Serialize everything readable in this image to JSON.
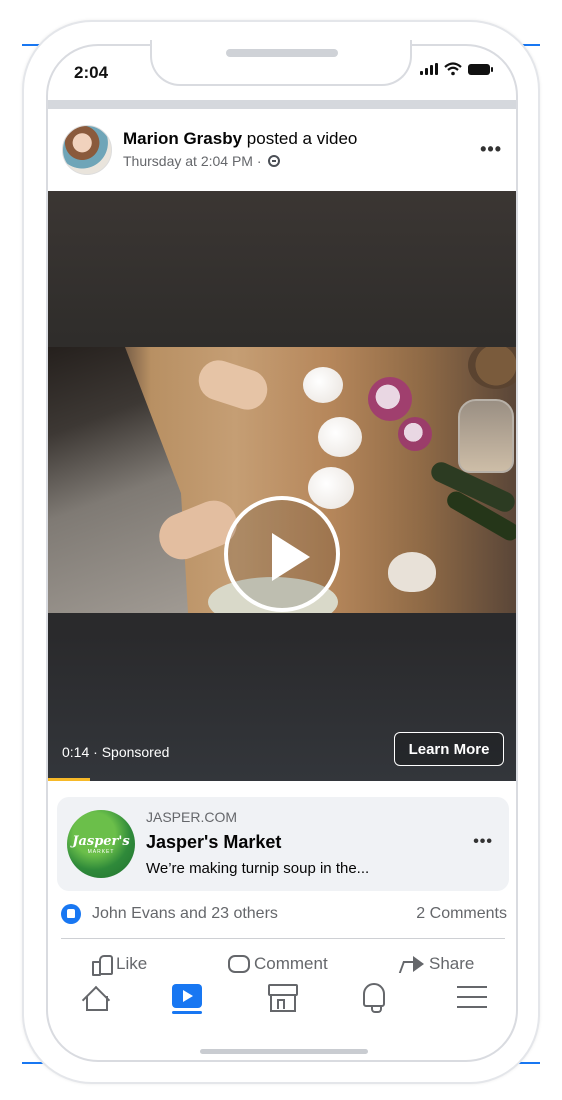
{
  "status_bar": {
    "time": "2:04"
  },
  "post": {
    "author": "Marion Grasby",
    "action": "posted a video",
    "timestamp": "Thursday at 2:04 PM · ",
    "audience_icon": "globe-icon",
    "more_icon": "•••"
  },
  "video": {
    "time_label": "0:14 · Sponsored",
    "cta_label": "Learn More",
    "progress_fraction": 0.09,
    "accent_color": "#f7b928"
  },
  "link_card": {
    "domain": "JASPER.COM",
    "title": "Jasper's Market",
    "description": "We’re making turnip soup in the...",
    "logo_text": "Jasper's",
    "logo_subtext": "MARKET",
    "more_icon": "•••"
  },
  "reactions": {
    "summary": "John Evans and 23 others",
    "comments": "2 Comments",
    "brand_color": "#1877f2"
  },
  "actions": [
    {
      "label": "Like",
      "icon": "thumbs-up-icon"
    },
    {
      "label": "Comment",
      "icon": "comment-icon"
    },
    {
      "label": "Share",
      "icon": "share-icon"
    }
  ],
  "tabbar": {
    "tabs": [
      {
        "name": "home",
        "icon": "home-icon",
        "active": false
      },
      {
        "name": "watch",
        "icon": "watch-icon",
        "active": true
      },
      {
        "name": "marketplace",
        "icon": "marketplace-icon",
        "active": false
      },
      {
        "name": "notifications",
        "icon": "bell-icon",
        "active": false
      },
      {
        "name": "menu",
        "icon": "menu-icon",
        "active": false
      }
    ]
  }
}
